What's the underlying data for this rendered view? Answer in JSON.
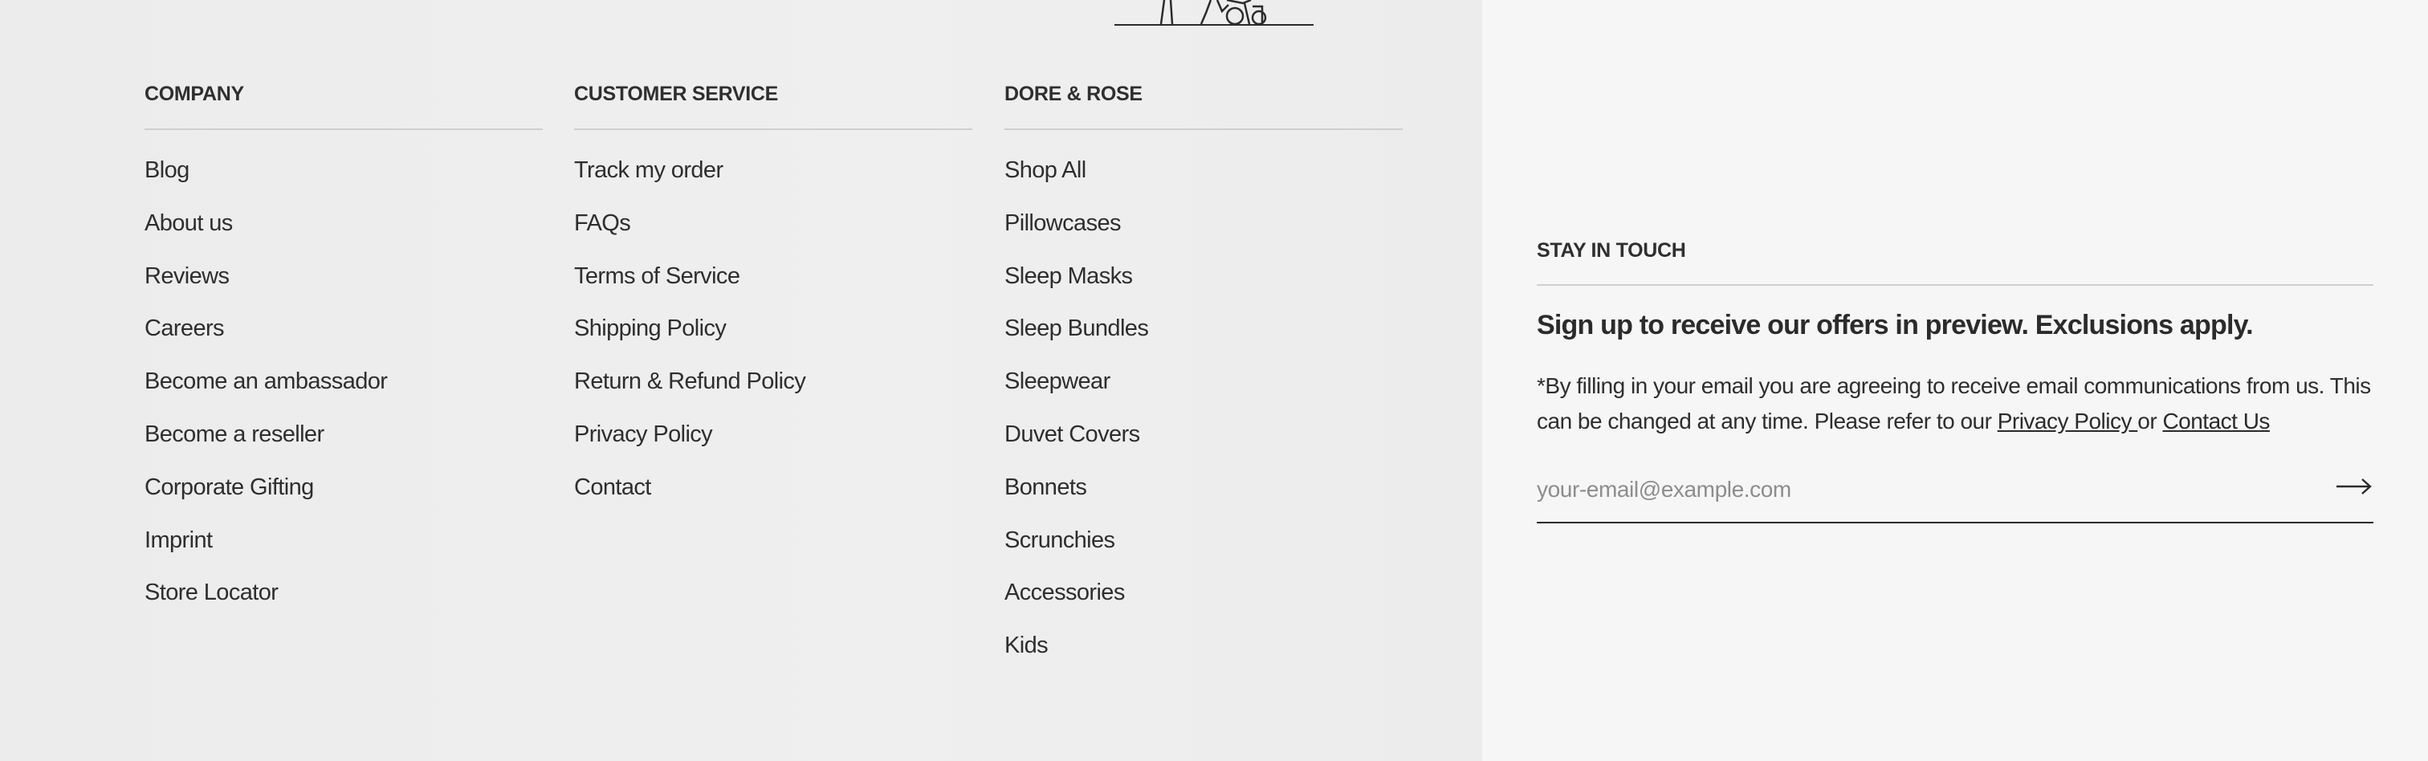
{
  "footer": {
    "columns": [
      {
        "heading": "COMPANY",
        "links": [
          "Blog",
          "About us",
          "Reviews",
          "Careers",
          "Become an ambassador",
          "Become a reseller",
          "Corporate Gifting",
          "Imprint",
          "Store Locator"
        ]
      },
      {
        "heading": "CUSTOMER SERVICE",
        "links": [
          "Track my order",
          "FAQs",
          "Terms of Service",
          "Shipping Policy",
          "Return & Refund Policy",
          "Privacy Policy",
          "Contact"
        ]
      },
      {
        "heading": "DORE & ROSE",
        "links": [
          "Shop All",
          "Pillowcases",
          "Sleep Masks",
          "Sleep Bundles",
          "Sleepwear",
          "Duvet Covers",
          "Bonnets",
          "Scrunchies",
          "Accessories",
          "Kids"
        ]
      }
    ]
  },
  "newsletter": {
    "heading": "STAY IN TOUCH",
    "title": "Sign up to receive our offers in preview. Exclusions apply.",
    "text_before": "*By filling in your email you are agreeing to receive email communications from us. This can be changed at any time. Please refer to our ",
    "privacy_link": "Privacy Policy ",
    "text_or": "or ",
    "contact_link": "Contact Us",
    "email_placeholder": "your-email@example.com",
    "submit_icon": "arrow-right-icon"
  },
  "colors": {
    "text": "#2b2b2b",
    "left_background": "#ededed",
    "right_background": "#f6f6f6",
    "rule": "#cfcfcf"
  }
}
